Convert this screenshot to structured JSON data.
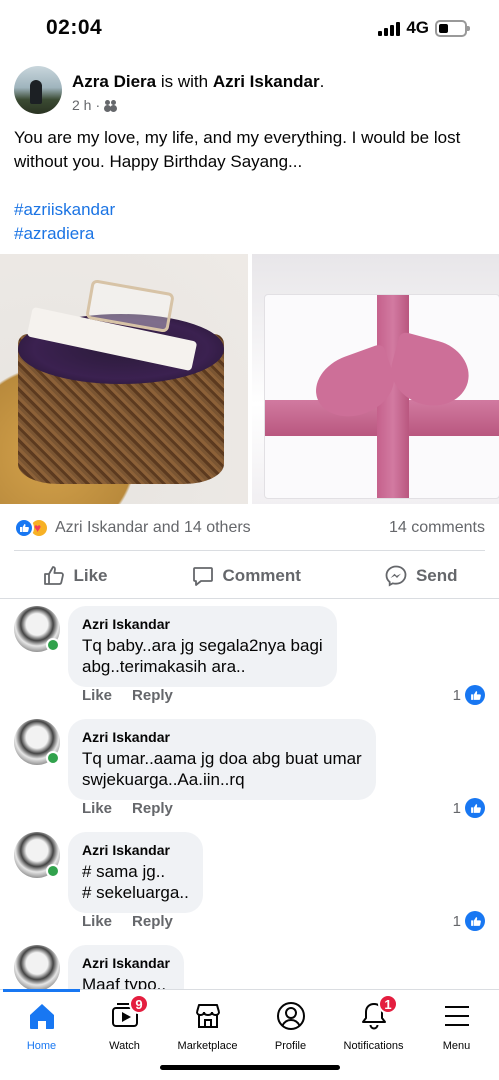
{
  "status_bar": {
    "time": "02:04",
    "network": "4G"
  },
  "post": {
    "author": "Azra Diera",
    "with_text": "is with",
    "tagged": "Azri Iskandar",
    "time": "2 h",
    "text": "You are my love, my life, and my everything. I would be lost without you. Happy Birthday Sayang...",
    "hashtags": [
      "#azriiskandar",
      "#azradiera"
    ],
    "reactions_text": "Azri Iskandar and 14 others",
    "comments_count": "14 comments"
  },
  "actions": {
    "like": "Like",
    "comment": "Comment",
    "send": "Send"
  },
  "comments": [
    {
      "name": "Azri Iskandar",
      "lines": [
        "Tq baby..ara jg segala2nya bagi",
        "abg..terimakasih ara.."
      ],
      "like": "Like",
      "reply": "Reply",
      "likes": "1"
    },
    {
      "name": "Azri Iskandar",
      "lines": [
        "Tq umar..aama jg doa abg buat umar",
        "swjekuarga..Aa.iin..rq"
      ],
      "like": "Like",
      "reply": "Reply",
      "likes": "1"
    },
    {
      "name": "Azri Iskandar",
      "lines": [
        "# sama jg..",
        "# sekeluarga.."
      ],
      "like": "Like",
      "reply": "Reply",
      "likes": "1"
    },
    {
      "name": "Azri Iskandar",
      "lines": [
        "Maaf typo.."
      ]
    }
  ],
  "tabbar": {
    "home": "Home",
    "watch": "Watch",
    "watch_badge": "9",
    "marketplace": "Marketplace",
    "profile": "Profile",
    "notifications": "Notifications",
    "notifications_badge": "1",
    "menu": "Menu"
  },
  "colors": {
    "accent": "#1877f2",
    "hashtag": "#1b74e4",
    "online": "#31a24c",
    "badge": "#e41e3f"
  },
  "icons": [
    "signal-icon",
    "battery-icon",
    "friends-icon",
    "like-icon",
    "comment-icon",
    "messenger-icon",
    "home-icon",
    "watch-icon",
    "marketplace-icon",
    "profile-icon",
    "bell-icon",
    "menu-icon"
  ]
}
